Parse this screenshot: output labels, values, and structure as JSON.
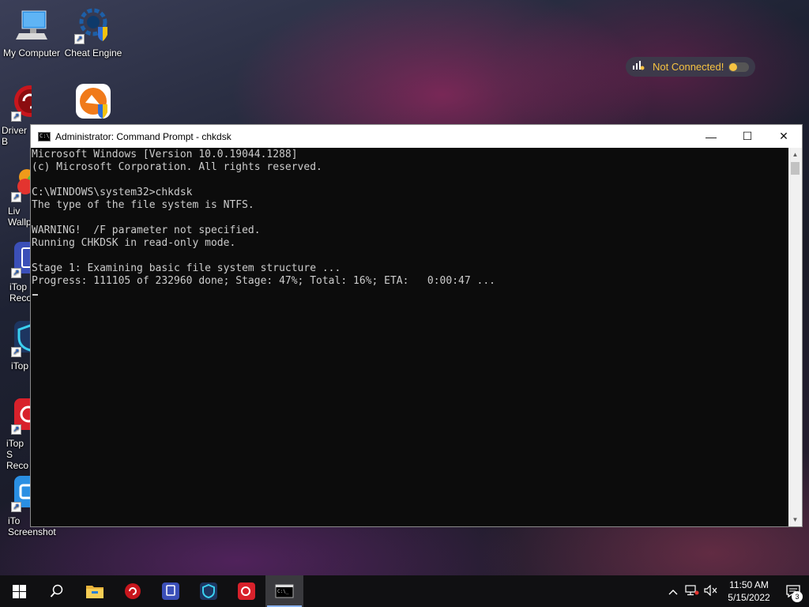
{
  "desktop": {
    "icons": [
      {
        "label": "My Computer",
        "icon": "computer-icon"
      },
      {
        "label": "Cheat Engine",
        "icon": "cheat-engine-icon"
      },
      {
        "label": "Driver B",
        "icon": "driver-booster-icon"
      },
      {
        "label": "",
        "icon": "avast-cleanup-icon"
      },
      {
        "label": "Liv Wallp",
        "icon": "lively-wallpaper-icon"
      },
      {
        "label": "iTop Reco",
        "icon": "itop-recovery-icon"
      },
      {
        "label": "iTop",
        "icon": "itop-vpn-icon"
      },
      {
        "label": "iTop S Reco",
        "icon": "itop-screen-recorder-icon"
      },
      {
        "label": "iTo Screenshot",
        "icon": "itop-screenshot-icon"
      }
    ]
  },
  "vpn_widget": {
    "status": "Not Connected!",
    "accent": "#f5c242"
  },
  "cmd": {
    "title": "Administrator: Command Prompt - chkdsk",
    "buttons": {
      "minimize": "—",
      "maximize": "☐",
      "close": "✕"
    },
    "lines": [
      "Microsoft Windows [Version 10.0.19044.1288]",
      "(c) Microsoft Corporation. All rights reserved.",
      "",
      "C:\\WINDOWS\\system32>chkdsk",
      "The type of the file system is NTFS.",
      "",
      "WARNING!  /F parameter not specified.",
      "Running CHKDSK in read-only mode.",
      "",
      "Stage 1: Examining basic file system structure ...",
      "Progress: 111105 of 232960 done; Stage: 47%; Total: 16%; ETA:   0:00:47 ..."
    ]
  },
  "taskbar": {
    "apps": [
      "start-icon",
      "search-icon",
      "file-explorer-icon",
      "driver-booster-icon",
      "itop-recovery-icon",
      "itop-vpn-icon",
      "itop-screen-recorder-icon",
      "command-prompt-icon"
    ],
    "active_app": "command-prompt-icon",
    "clock": {
      "time": "11:50 AM",
      "date": "5/15/2022"
    },
    "notification_count": "3"
  }
}
